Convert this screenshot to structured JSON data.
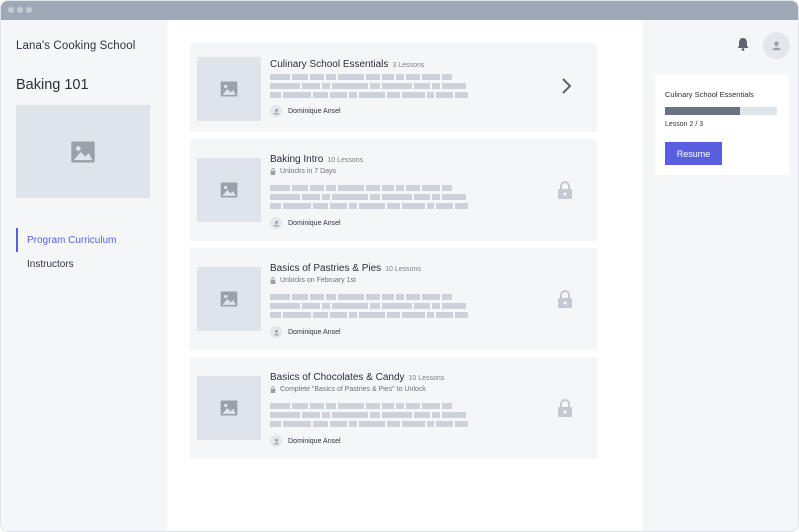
{
  "window": {
    "controls": [
      "close-dot",
      "minimize-dot",
      "maximize-dot"
    ]
  },
  "sidebar": {
    "school_name": "Lana's Cooking School",
    "course_title": "Baking 101",
    "nav": [
      {
        "label": "Program Curriculum",
        "active": true
      },
      {
        "label": "Instructors",
        "active": false
      }
    ]
  },
  "courses": [
    {
      "title": "Culinary School Essentials",
      "lessons": "3 Lessons",
      "status": "",
      "author": "Dominique Ansel",
      "icon": "chevron-right-icon"
    },
    {
      "title": "Baking Intro",
      "lessons": "10 Lessons",
      "status": "Unlocks in 7 Days",
      "author": "Dominique Ansel",
      "icon": "lock-icon"
    },
    {
      "title": "Basics of Pastries & Pies",
      "lessons": "10 Lessons",
      "status": "Unlocks on February 1st",
      "author": "Dominique Ansel",
      "icon": "lock-icon"
    },
    {
      "title": "Basics of Chocolates & Candy",
      "lessons": "10 Lessons",
      "status": "Complete \"Basics of Pastries & Pies\" to Unlock",
      "author": "Dominique Ansel",
      "icon": "lock-icon"
    }
  ],
  "right_panel": {
    "icons": [
      "bell-icon",
      "user-avatar-icon"
    ],
    "progress": {
      "title": "Culinary School Essentials",
      "fraction": 0.67,
      "lesson_label": "Lesson 2 / 3",
      "button_label": "Resume"
    }
  },
  "colors": {
    "accent": "#5a5fe0",
    "placeholder": "#dfe3ea",
    "skeleton": "#cdd2da",
    "progress_fill": "#6b7382"
  }
}
